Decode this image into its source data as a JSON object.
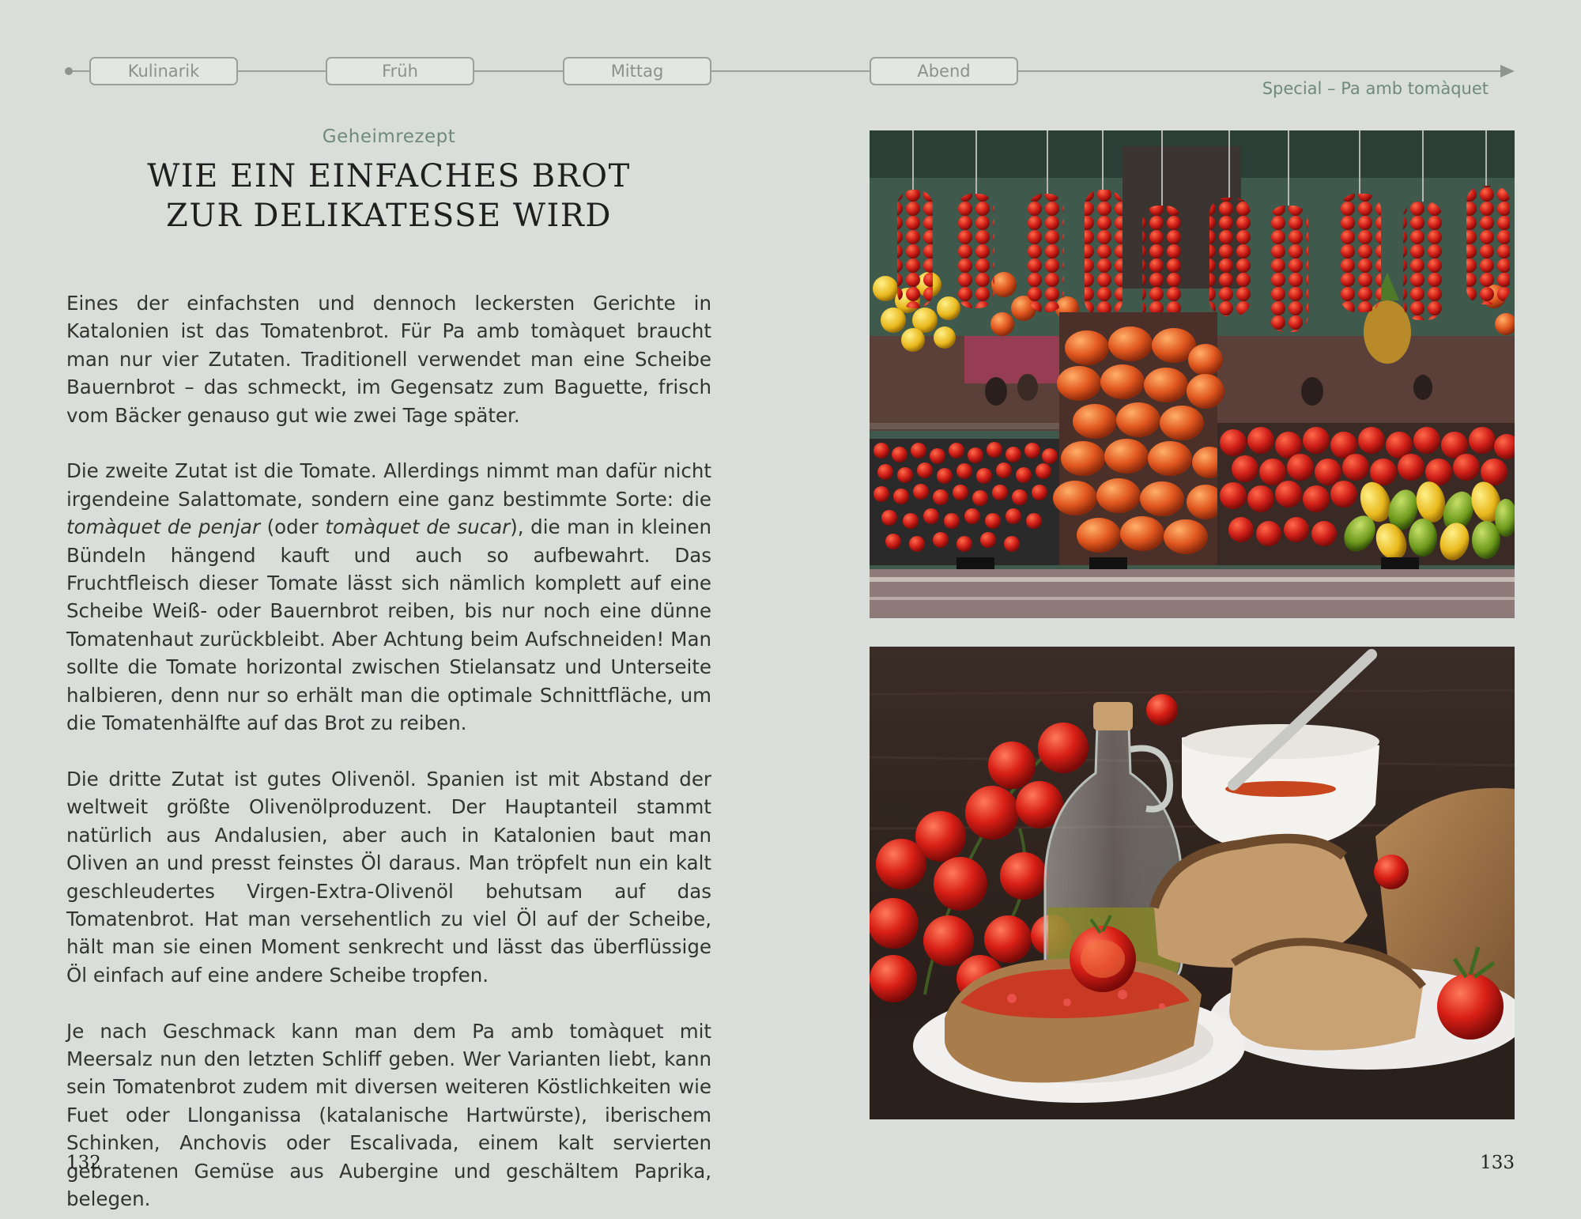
{
  "nav": {
    "tabs": [
      {
        "label": "Kulinarik"
      },
      {
        "label": "Früh"
      },
      {
        "label": "Mittag"
      },
      {
        "label": "Abend"
      }
    ],
    "special": "Special – Pa amb tomàquet"
  },
  "article": {
    "kicker": "Geheimrezept",
    "title_line1": "WIE EIN EINFACHES BROT",
    "title_line2": "ZUR DELIKATESSE WIRD",
    "paragraphs": [
      {
        "text": "Eines der einfachsten und dennoch leckersten Gerichte in Katalonien ist das Tomatenbrot. Für Pa amb tomàquet braucht man nur vier Zutaten. Traditionell verwendet man eine Scheibe Bauernbrot – das schmeckt, im Gegensatz zum Baguette, frisch vom Bäcker genauso gut wie zwei Tage später."
      },
      {
        "text_a": "Die zweite Zutat ist die Tomate. Allerdings nimmt man dafür nicht irgendeine Salattomate, sondern eine ganz bestimmte Sorte: die ",
        "em_a": "tomàquet de penjar",
        "text_b": " (oder ",
        "em_b": "tomàquet de sucar",
        "text_c": "), die man in kleinen Bündeln hängend kauft und auch so aufbewahrt. Das Fruchtfleisch dieser Tomate lässt sich nämlich komplett auf eine Scheibe Weiß- oder Bauernbrot reiben, bis nur noch eine dünne Tomatenhaut zurückbleibt. Aber Achtung beim Aufschneiden! Man sollte die Tomate horizontal zwischen Stielansatz und Unterseite halbieren, denn nur so erhält man die optimale Schnittfläche, um die Tomatenhälfte auf das Brot zu reiben."
      },
      {
        "text": "Die dritte Zutat ist gutes Olivenöl. Spanien ist mit Abstand der weltweit größte Olivenölproduzent. Der Hauptanteil stammt natürlich aus Andalusien, aber auch in Katalonien baut man Oliven an und presst feinstes Öl daraus. Man tröpfelt nun ein kalt geschleudertes Virgen-Extra-Olivenöl behutsam auf das Tomatenbrot. Hat man versehentlich zu viel Öl auf der Scheibe, hält man sie einen Moment senkrecht und lässt das überflüssige Öl einfach auf eine andere Scheibe tropfen."
      },
      {
        "text": "Je nach Geschmack kann man dem Pa amb tomàquet mit Meersalz nun den letzten Schliff geben. Wer Varianten liebt, kann sein Tomatenbrot zudem mit diversen weiteren Köstlichkeiten wie Fuet oder Llonganissa (katalanische Hartwürste), iberischem Schinken, Anchovis oder Escalivada, einem kalt servierten gebratenen Gemüse aus Aubergine und geschältem Paprika, belegen."
      }
    ]
  },
  "pages": {
    "left": "132",
    "right": "133"
  },
  "colors": {
    "background": "#d9dedb",
    "accent_green": "#6f8a7c",
    "tomato_red": "#d0241c"
  }
}
